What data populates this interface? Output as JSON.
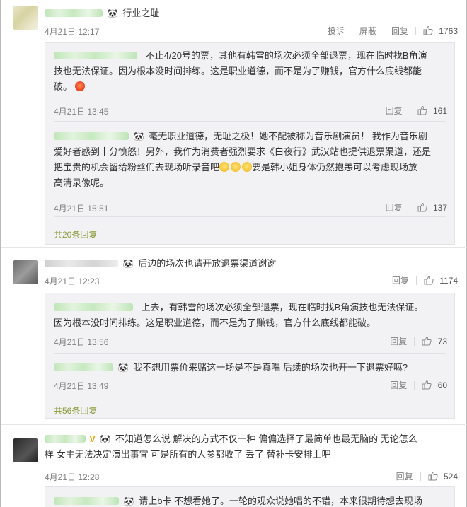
{
  "comments": [
    {
      "name_suffix": "行业之耻",
      "date": "4月21日 12:17",
      "actions": {
        "report": "投诉",
        "block": "屏蔽",
        "reply": "回复",
        "likes": "1763"
      },
      "replies": [
        {
          "lines": [
            "不止4/20号的票，其他有韩雪的场次必须全部退票，现在临时找B角演",
            "技也无法保证。因为根本没时间排练。这是职业道德，而不是为了赚钱，官方什么底线都能",
            "破。"
          ],
          "date": "4月21日 13:45",
          "reply": "回复",
          "likes": "161"
        },
        {
          "lines": [
            "毫无职业道德，无耻之极！她不配被称为音乐剧演员！ 我作为音乐剧",
            "爱好者感到十分愤怒！另外，我作为消费者强烈要求《白夜行》武汉站也提供退票渠道，还是",
            "把宝贵的机会留给粉丝们去现场听录音吧",
            "要是韩小姐身体仍然抱恙可以考虑现场放",
            "高清录像呢。"
          ],
          "date": "4月21日 15:51",
          "reply": "回复",
          "likes": "137"
        }
      ],
      "more": "共20条回复"
    },
    {
      "name_suffix": "后边的场次也请开放退票渠道谢谢",
      "date": "4月21日 12:23",
      "actions": {
        "reply": "回复",
        "likes": "1174"
      },
      "replies": [
        {
          "lines": [
            "上去，有韩雪的场次必须全部退票，现在临时找B角演技也无法保证。",
            "因为根本没时间排练。这是职业道德，而不是为了赚钱，官方什么底线都能破。"
          ],
          "date": "4月21日 13:56",
          "reply": "回复",
          "likes": "73"
        },
        {
          "lines": [
            "我不想用票价来赌这一场是不是真唱 后续的场次也开一下退票好嘛?"
          ],
          "date": "4月21日 13:49",
          "reply": "回复",
          "likes": "60"
        }
      ],
      "more": "共56条回复"
    },
    {
      "lines": [
        "不知道怎么说 解决的方式不仅一种 偏偏选择了最简单也最无脑的 无论怎么",
        "样 女主无法决定演出事宜 可是所有的人参都收了 丢了 替补卡安排上吧"
      ],
      "badge": "V",
      "date": "4月21日 12:28",
      "actions": {
        "reply": "回复",
        "likes": "524"
      }
    },
    {
      "line": "请上b卡 不想看她了。一轮的观众说她唱的不错，本来很期待想去现场"
    }
  ]
}
